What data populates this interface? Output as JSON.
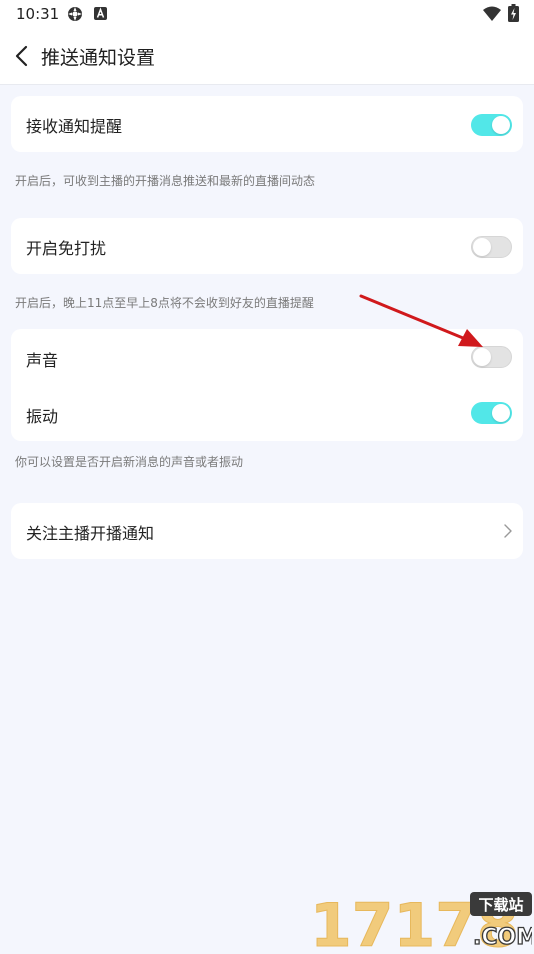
{
  "status_bar": {
    "time": "10:31"
  },
  "header": {
    "title": "推送通知设置"
  },
  "sections": {
    "receive": {
      "label": "接收通知提醒",
      "on": true,
      "hint": "开启后，可收到主播的开播消息推送和最新的直播间动态"
    },
    "dnd": {
      "label": "开启免打扰",
      "on": false,
      "hint": "开启后，晚上11点至早上8点将不会收到好友的直播提醒"
    },
    "sound": {
      "label": "声音",
      "on": false
    },
    "vibration": {
      "label": "振动",
      "on": true,
      "hint": "你可以设置是否开启新消息的声音或者振动"
    },
    "follow": {
      "label": "关注主播开播通知"
    }
  },
  "watermark": {
    "number": "17178",
    "badge": "下载站",
    "domain": ".COM"
  },
  "colors": {
    "toggle_on": "#52e7e8",
    "toggle_off": "#e3e3e3",
    "background": "#f4f6fd",
    "annotation_arrow": "#d0191c"
  },
  "icons": [
    "gear-status-icon",
    "a-status-icon",
    "wifi-icon",
    "battery-icon",
    "back-arrow-icon",
    "chevron-right-icon"
  ]
}
